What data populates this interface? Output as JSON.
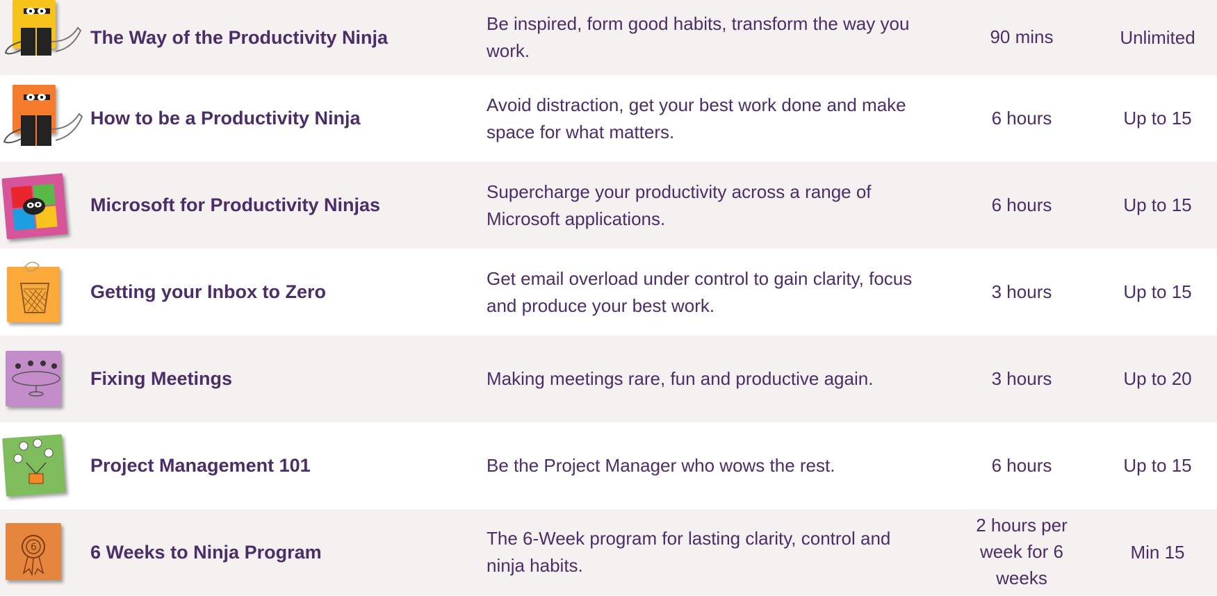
{
  "courses": [
    {
      "icon": "ninja-reading-icon",
      "title": "The Way of the Productivity Ninja",
      "description": "Be inspired, form good habits, transform the way you work.",
      "duration": "90 mins",
      "group_size": "Unlimited"
    },
    {
      "icon": "ninja-reading-icon",
      "title": "How to be a Productivity Ninja",
      "description": "Avoid distraction, get your best work done and make space for what matters.",
      "duration": "6 hours",
      "group_size": "Up to 15"
    },
    {
      "icon": "ninja-windows-icon",
      "title": "Microsoft for Productivity Ninjas",
      "description": "Supercharge your productivity across a range of Microsoft applications.",
      "duration": "6 hours",
      "group_size": "Up to 15"
    },
    {
      "icon": "wastebasket-icon",
      "title": "Getting your Inbox to Zero",
      "description": "Get email overload under control to gain clarity, focus and produce your best work.",
      "duration": "3 hours",
      "group_size": "Up to 15"
    },
    {
      "icon": "meeting-table-icon",
      "title": "Fixing Meetings",
      "description": "Making meetings rare, fun and productive again.",
      "duration": "3 hours",
      "group_size": "Up to 20"
    },
    {
      "icon": "project-clips-icon",
      "title": "Project Management 101",
      "description": "Be the Project Manager who wows the rest.",
      "duration": "6 hours",
      "group_size": "Up to 15"
    },
    {
      "icon": "rosette-six-icon",
      "title": "6 Weeks to Ninja Program",
      "description": "The 6-Week program for lasting clarity, control and ninja habits.",
      "duration": "2 hours per week for 6 weeks",
      "group_size": "Min 15"
    }
  ],
  "colors": {
    "text": "#4b2d68",
    "row_alt": "#f5f1f1",
    "yellow_note": "#f7c21b",
    "orange_note": "#f47c2c",
    "pink_note": "#d6549a",
    "light_orange_note": "#fba93b",
    "purple_note": "#c48cc8",
    "green_note": "#7fbc5b",
    "copper_note": "#e6863e"
  }
}
